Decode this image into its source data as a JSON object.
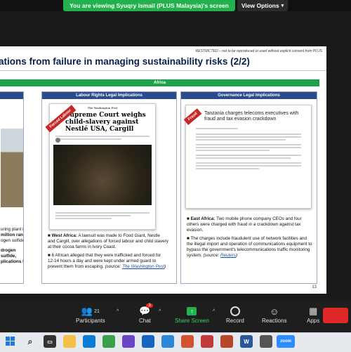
{
  "banner": {
    "viewing_text": "You are viewing Syuqry Ismail (PLUS Malaysia)'s screen",
    "view_options_label": "View Options"
  },
  "slide": {
    "restricted_notice": "RESTRICTED – not to be reproduced or used without explicit consent from PLUS",
    "title": "ations from failure in managing sustainability risks (2/2)",
    "region_bar": "Africa",
    "page_number": "13",
    "left_panel": {
      "partial_lines": [
        "uring plant in",
        "million rand",
        "ogen sulfide",
        "drogen sulfide,",
        "plications to"
      ]
    },
    "labour_panel": {
      "header": "Labour Rights Legal Implications",
      "stamp": "Forced Labour",
      "article_masthead": "The Washington Post",
      "article_headline": "Supreme Court weighs child-slavery against Nestlé USA, Cargill",
      "bullets": [
        {
          "bold": "West Africa:",
          "text": " A lawsuit was made to Food Giant, Nestle and Cargill, over allegations of forced labour and child slavery at their cocoa farms in Ivory Coast."
        },
        {
          "bold": "",
          "text": "6 African alleged that they were trafficked and forced for 12-14 hours a day and were kept under armed guard to prevent them from escaping. ",
          "source_prefix": "(source: ",
          "source_link": "The Washington Post",
          "source_suffix": ")"
        }
      ]
    },
    "governance_panel": {
      "header": "Governance Legal Implications",
      "stamp": "Fraud",
      "article_headline": "Tanzania charges telecoms executives with fraud and tax evasion crackdown",
      "bullets": [
        {
          "bold": "East Africa:",
          "text": " Two mobile phone company CEOs and four others were charged with fraud in a crackdown against tax evasion."
        },
        {
          "bold": "",
          "text": "The charges include fraudulent use of network facilities and the illegal import and operation of communications equipment to bypass the government's telecommunications traffic monitoring system. ",
          "source_prefix": "(source: ",
          "source_link": "Reuters",
          "source_suffix": ")"
        }
      ]
    }
  },
  "toolbar": {
    "participants_label": "Participants",
    "participants_count": "21",
    "chat_label": "Chat",
    "chat_badge": "3",
    "share_label": "Share Screen",
    "record_label": "Record",
    "reactions_label": "Reactions",
    "apps_label": "Apps"
  },
  "taskbar": {
    "word_label": "W",
    "zoom_label": "zoom"
  },
  "colors": {
    "accent_green": "#22b14c",
    "title_navy": "#0b1f4b",
    "panel_blue": "#2a4b8d",
    "stamp_red": "#c62828"
  }
}
